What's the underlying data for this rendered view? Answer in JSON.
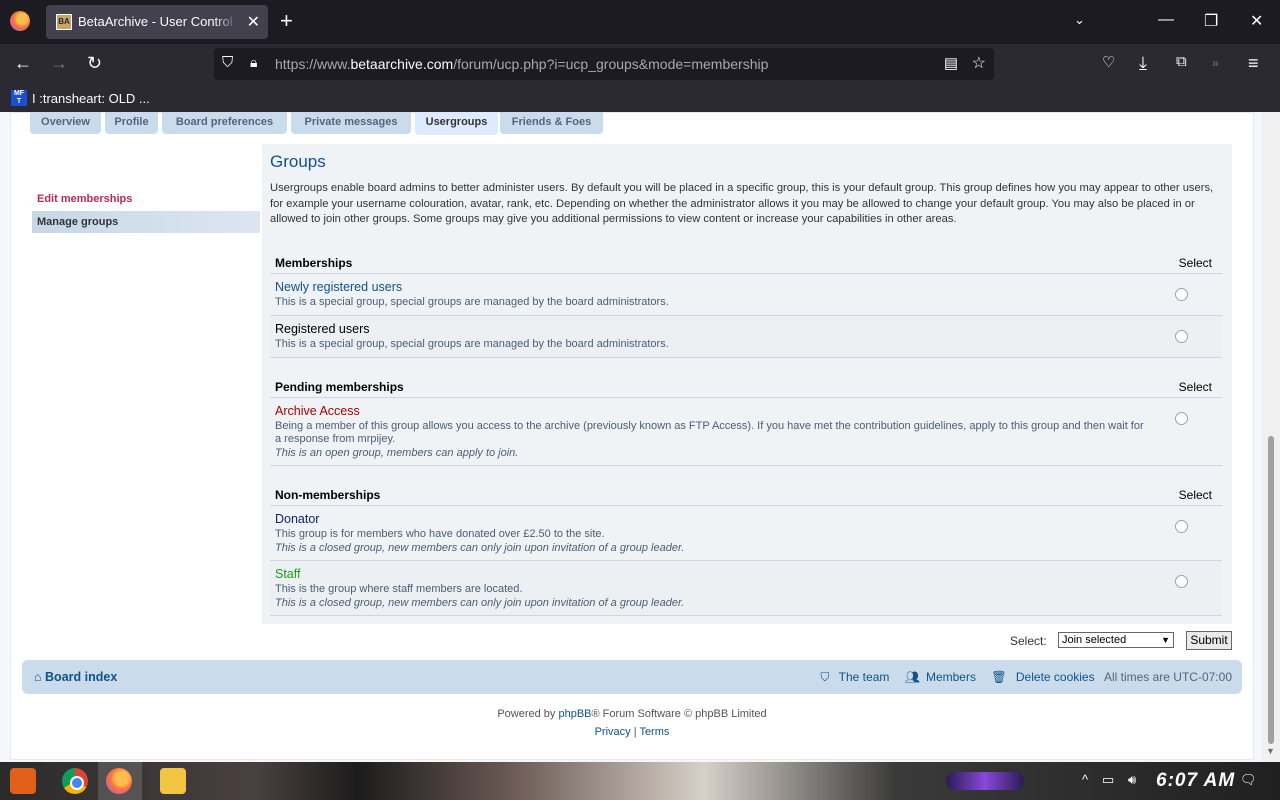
{
  "browser": {
    "tab_title": "BetaArchive - User Control Panel",
    "tab_favicon_text": "BA",
    "url_prefix": "https://www.",
    "url_host": "betaarchive.com",
    "url_path": "/forum/ucp.php?i=ucp_groups&mode=membership",
    "bookmark_icon_text": "MF T",
    "bookmark_label": "I :transheart: OLD ..."
  },
  "ucp": {
    "tabs": [
      {
        "label": "Overview"
      },
      {
        "label": "Profile"
      },
      {
        "label": "Board preferences"
      },
      {
        "label": "Private messages"
      },
      {
        "label": "Usergroups"
      },
      {
        "label": "Friends & Foes"
      }
    ],
    "menu": {
      "current": "Edit memberships",
      "other": "Manage groups"
    },
    "heading": "Groups",
    "intro": "Usergroups enable board admins to better administer users. By default you will be placed in a specific group, this is your default group. This group defines how you may appear to other users, for example your username colouration, avatar, rank, etc. Depending on whether the administrator allows it you may be allowed to change your default group. You may also be placed in or allowed to join other groups. Some groups may give you additional permissions to view content or increase your capabilities in other areas.",
    "select_header": "Select",
    "memberships": {
      "title": "Memberships",
      "rows": [
        {
          "name": "Newly registered users",
          "desc": "This is a special group, special groups are managed by the board administrators."
        },
        {
          "name": "Registered users",
          "desc": "This is a special group, special groups are managed by the board administrators."
        }
      ]
    },
    "pending": {
      "title": "Pending memberships",
      "rows": [
        {
          "name": "Archive Access",
          "desc": "Being a member of this group allows you access to the archive (previously known as FTP Access). If you have met the contribution guidelines, apply to this group and then wait for a response from mrpijey.",
          "note": "This is an open group, members can apply to join."
        }
      ]
    },
    "non_memberships": {
      "title": "Non-memberships",
      "rows": [
        {
          "name": "Donator",
          "desc": "This group is for members who have donated over £2.50 to the site.",
          "note": "This is a closed group, new members can only join upon invitation of a group leader."
        },
        {
          "name": "Staff",
          "desc": "This is the group where staff members are located.",
          "note": "This is a closed group, new members can only join upon invitation of a group leader."
        }
      ]
    },
    "action": {
      "label": "Select:",
      "selected": "Join selected",
      "submit": "Submit"
    }
  },
  "footer": {
    "home": "Board index",
    "team": "The team",
    "members": "Members",
    "cookies": "Delete cookies",
    "timezone": "All times are UTC-07:00",
    "powered_prefix": "Powered by ",
    "powered_link": "phpBB",
    "powered_suffix": "® Forum Software © phpBB Limited",
    "privacy": "Privacy",
    "separator": "|",
    "terms": "Terms"
  },
  "taskbar": {
    "clock": "6:07 AM"
  },
  "colors": {
    "tab_bg": "#cadceb",
    "tab_active": "#dcebfe",
    "link": "#105289",
    "current_menu": "#bc2a4d",
    "archive_access": "#aa0000",
    "staff": "#16a016",
    "donator": "#0b1f7a"
  }
}
